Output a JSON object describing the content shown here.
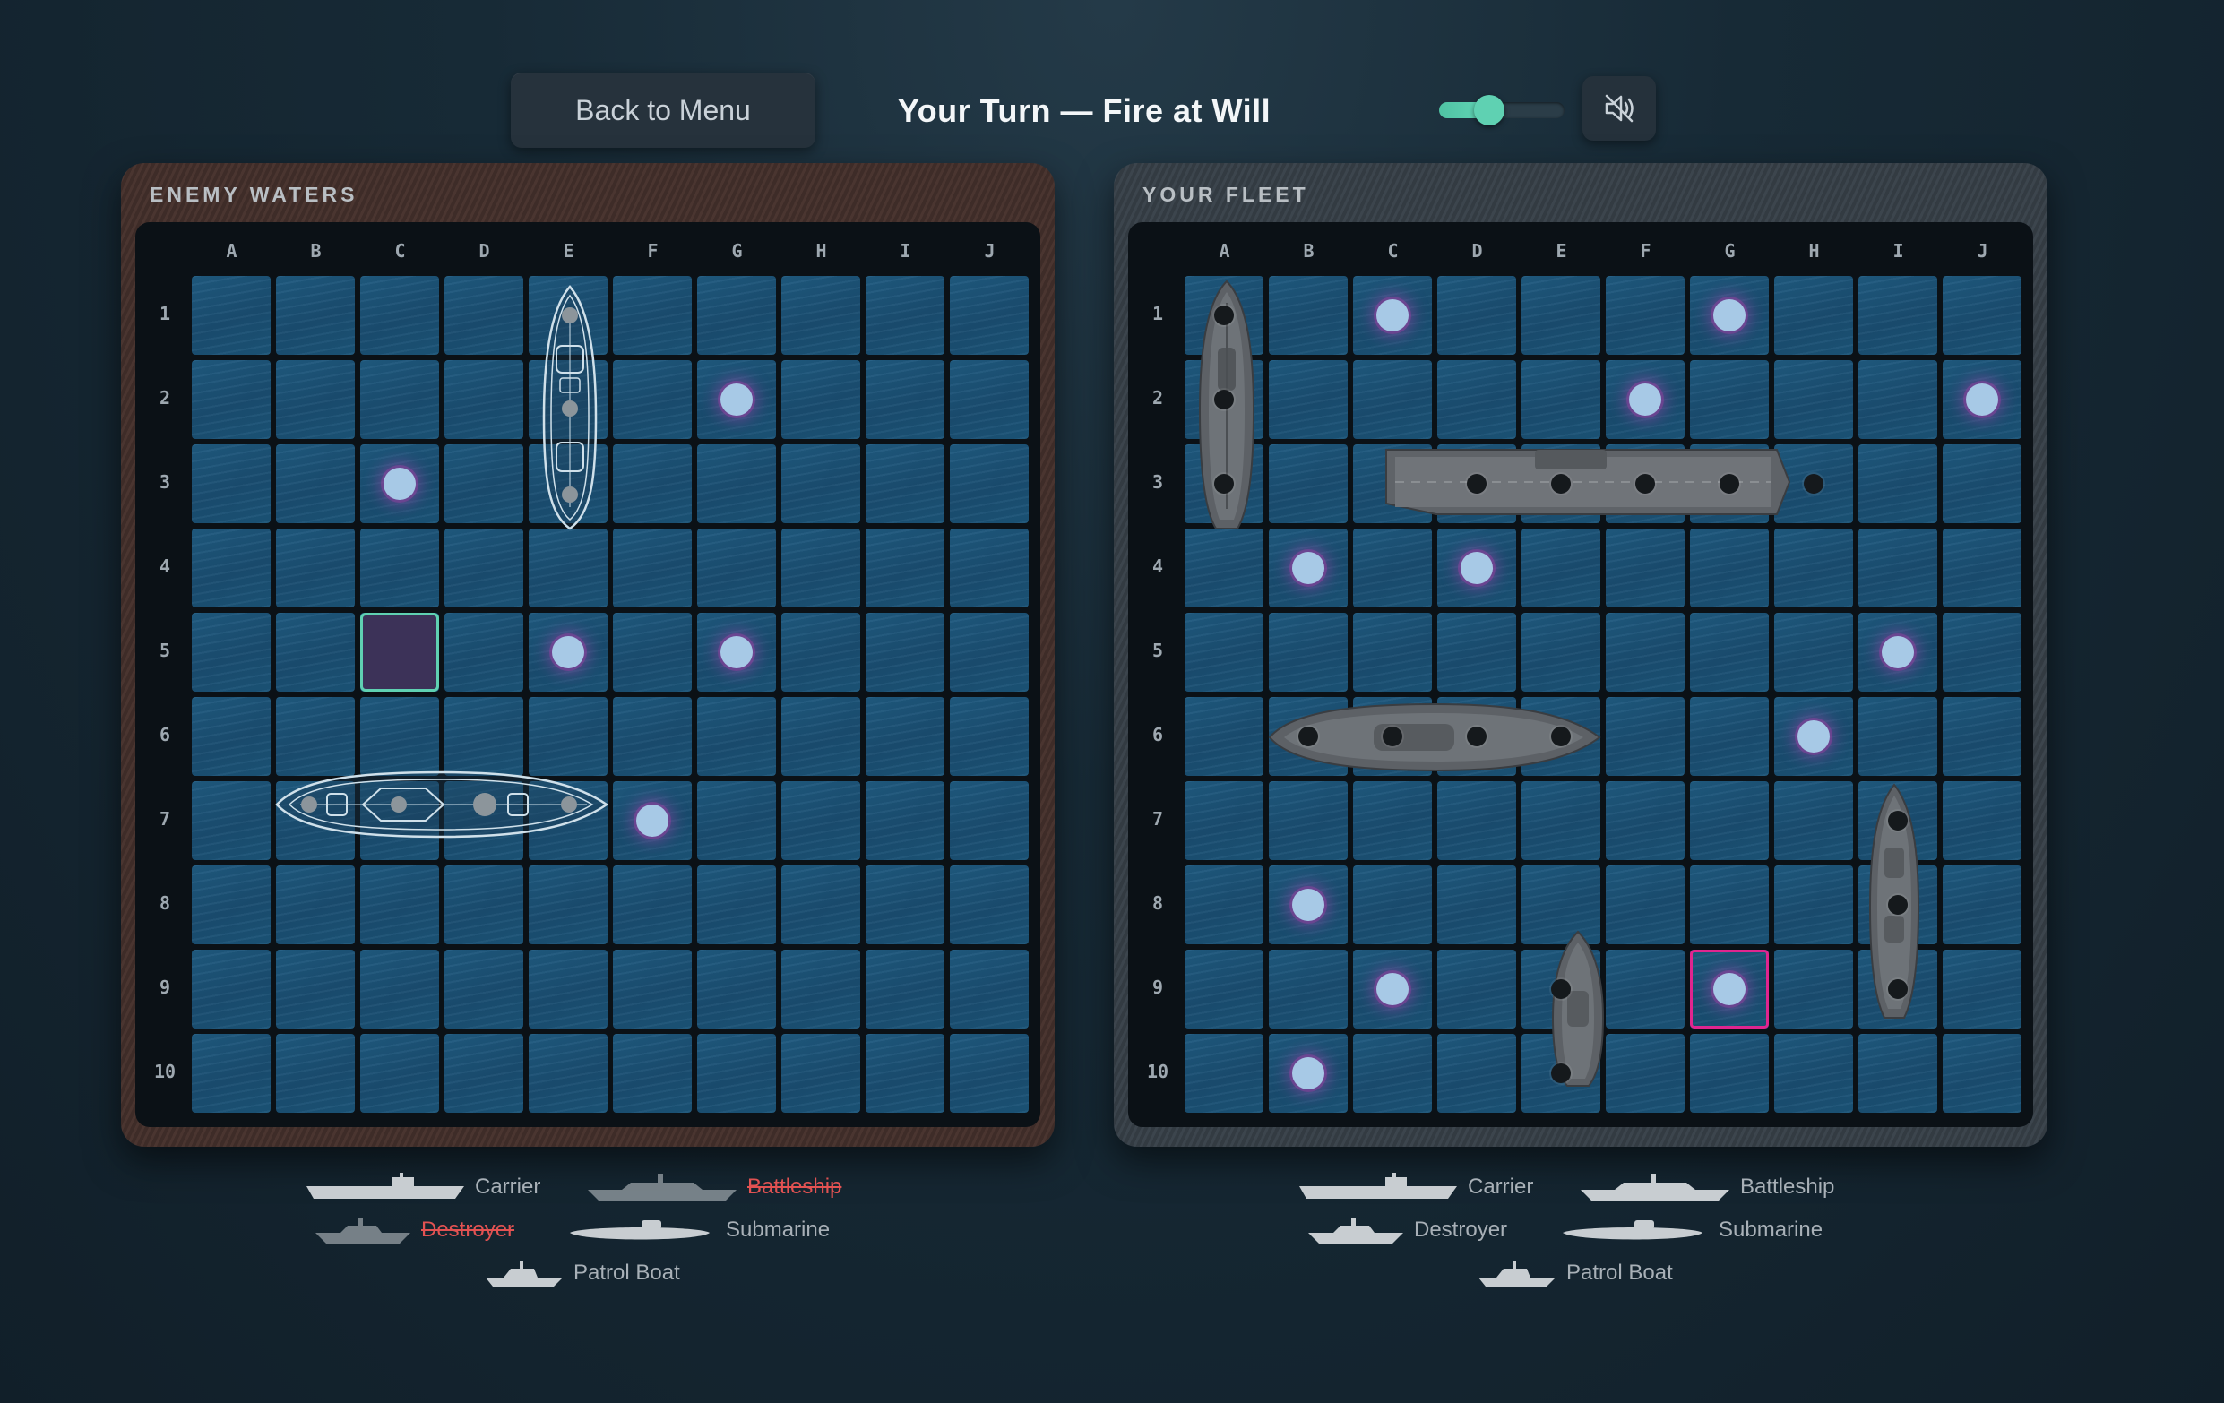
{
  "header": {
    "back_label": "Back to Menu",
    "turn_title": "Your Turn — Fire at Will",
    "volume": 0.4,
    "sound_icon": "speaker-muted-icon"
  },
  "columns": [
    "A",
    "B",
    "C",
    "D",
    "E",
    "F",
    "G",
    "H",
    "I",
    "J"
  ],
  "rows": [
    "1",
    "2",
    "3",
    "4",
    "5",
    "6",
    "7",
    "8",
    "9",
    "10"
  ],
  "enemy": {
    "title": "ENEMY WATERS",
    "misses": [
      "G2",
      "C3",
      "E5",
      "G5",
      "F7"
    ],
    "cursor": "C5",
    "legend": [
      {
        "name": "Carrier",
        "sunk": false
      },
      {
        "name": "Battleship",
        "sunk": true
      },
      {
        "name": "Destroyer",
        "sunk": true
      },
      {
        "name": "Submarine",
        "sunk": false
      },
      {
        "name": "Patrol Boat",
        "sunk": false
      }
    ]
  },
  "fleet": {
    "title": "YOUR FLEET",
    "misses": [
      "C1",
      "G1",
      "F2",
      "J2",
      "B4",
      "D4",
      "I5",
      "H6",
      "B8",
      "C9",
      "G9",
      "B10"
    ],
    "cursor": "G9",
    "legend": [
      {
        "name": "Carrier",
        "sunk": false
      },
      {
        "name": "Battleship",
        "sunk": false
      },
      {
        "name": "Destroyer",
        "sunk": false
      },
      {
        "name": "Submarine",
        "sunk": false
      },
      {
        "name": "Patrol Boat",
        "sunk": false
      }
    ]
  },
  "colors": {
    "miss": "#a7c9e6",
    "cursor_enemy": "#5fd1b2",
    "cursor_fleet": "#e0258f",
    "sunk": "#e25252"
  }
}
